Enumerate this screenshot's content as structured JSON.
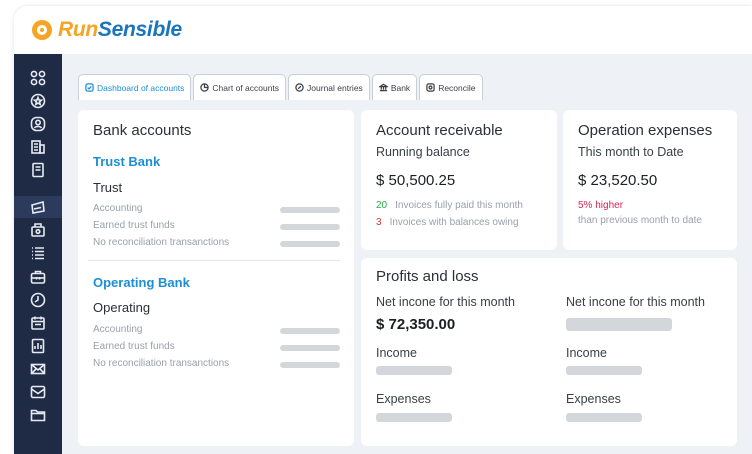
{
  "brand": {
    "part1": "Run",
    "part2": "Sensible"
  },
  "sidebar": {
    "icons": [
      "dashboard-grid-icon",
      "badge-icon",
      "user-circle-icon",
      "building-icon",
      "document-icon",
      "wallet-card-icon",
      "cash-register-icon",
      "list-icon",
      "briefcase-icon",
      "clock-icon",
      "calendar-icon",
      "report-icon",
      "envelope-icon",
      "mail-inbox-icon",
      "folder-icon"
    ]
  },
  "tabs": [
    {
      "label": "Dashboard of accounts",
      "icon": "dashboard-tab-icon",
      "active": true
    },
    {
      "label": "Chart of accounts",
      "icon": "chart-tab-icon",
      "active": false
    },
    {
      "label": "Journal entries",
      "icon": "journal-tab-icon",
      "active": false
    },
    {
      "label": "Bank",
      "icon": "bank-tab-icon",
      "active": false
    },
    {
      "label": "Reconcile",
      "icon": "reconcile-tab-icon",
      "active": false
    }
  ],
  "bank_accounts": {
    "title": "Bank accounts",
    "trust": {
      "link": "Trust Bank",
      "name": "Trust",
      "rows": [
        "Accounting",
        "Earned trust funds",
        "No reconciliation transanctions"
      ]
    },
    "operating": {
      "link": "Operating Bank",
      "name": "Operating",
      "rows": [
        "Accounting",
        "Earned trust funds",
        "No reconciliation transanctions"
      ]
    }
  },
  "account_receivable": {
    "title": "Account receivable",
    "subtitle": "Running balance",
    "amount": "$ 50,500.25",
    "paid_count": "20",
    "paid_text": "Invoices fully paid this month",
    "owing_count": "3",
    "owing_text": "Invoices with balances owing"
  },
  "operation_expenses": {
    "title": "Operation expenses",
    "subtitle": "This month to Date",
    "amount": "$ 23,520.50",
    "change": "5% higher",
    "change_note": "than previous month to date"
  },
  "profits_loss": {
    "title": "Profits and loss",
    "col1": {
      "label": "Net incone for this month",
      "amount": "$ 72,350.00",
      "income": "Income",
      "expenses": "Expenses"
    },
    "col2": {
      "label": "Net incone for this month",
      "income": "Income",
      "expenses": "Expenses"
    }
  },
  "colors": {
    "accent": "#1a8fd6",
    "sidebar": "#1f2a44",
    "brand_orange": "#f5a524",
    "brand_blue": "#1b75bc",
    "positive": "#27a844",
    "negative": "#d9363e",
    "pink": "#d6245a"
  }
}
